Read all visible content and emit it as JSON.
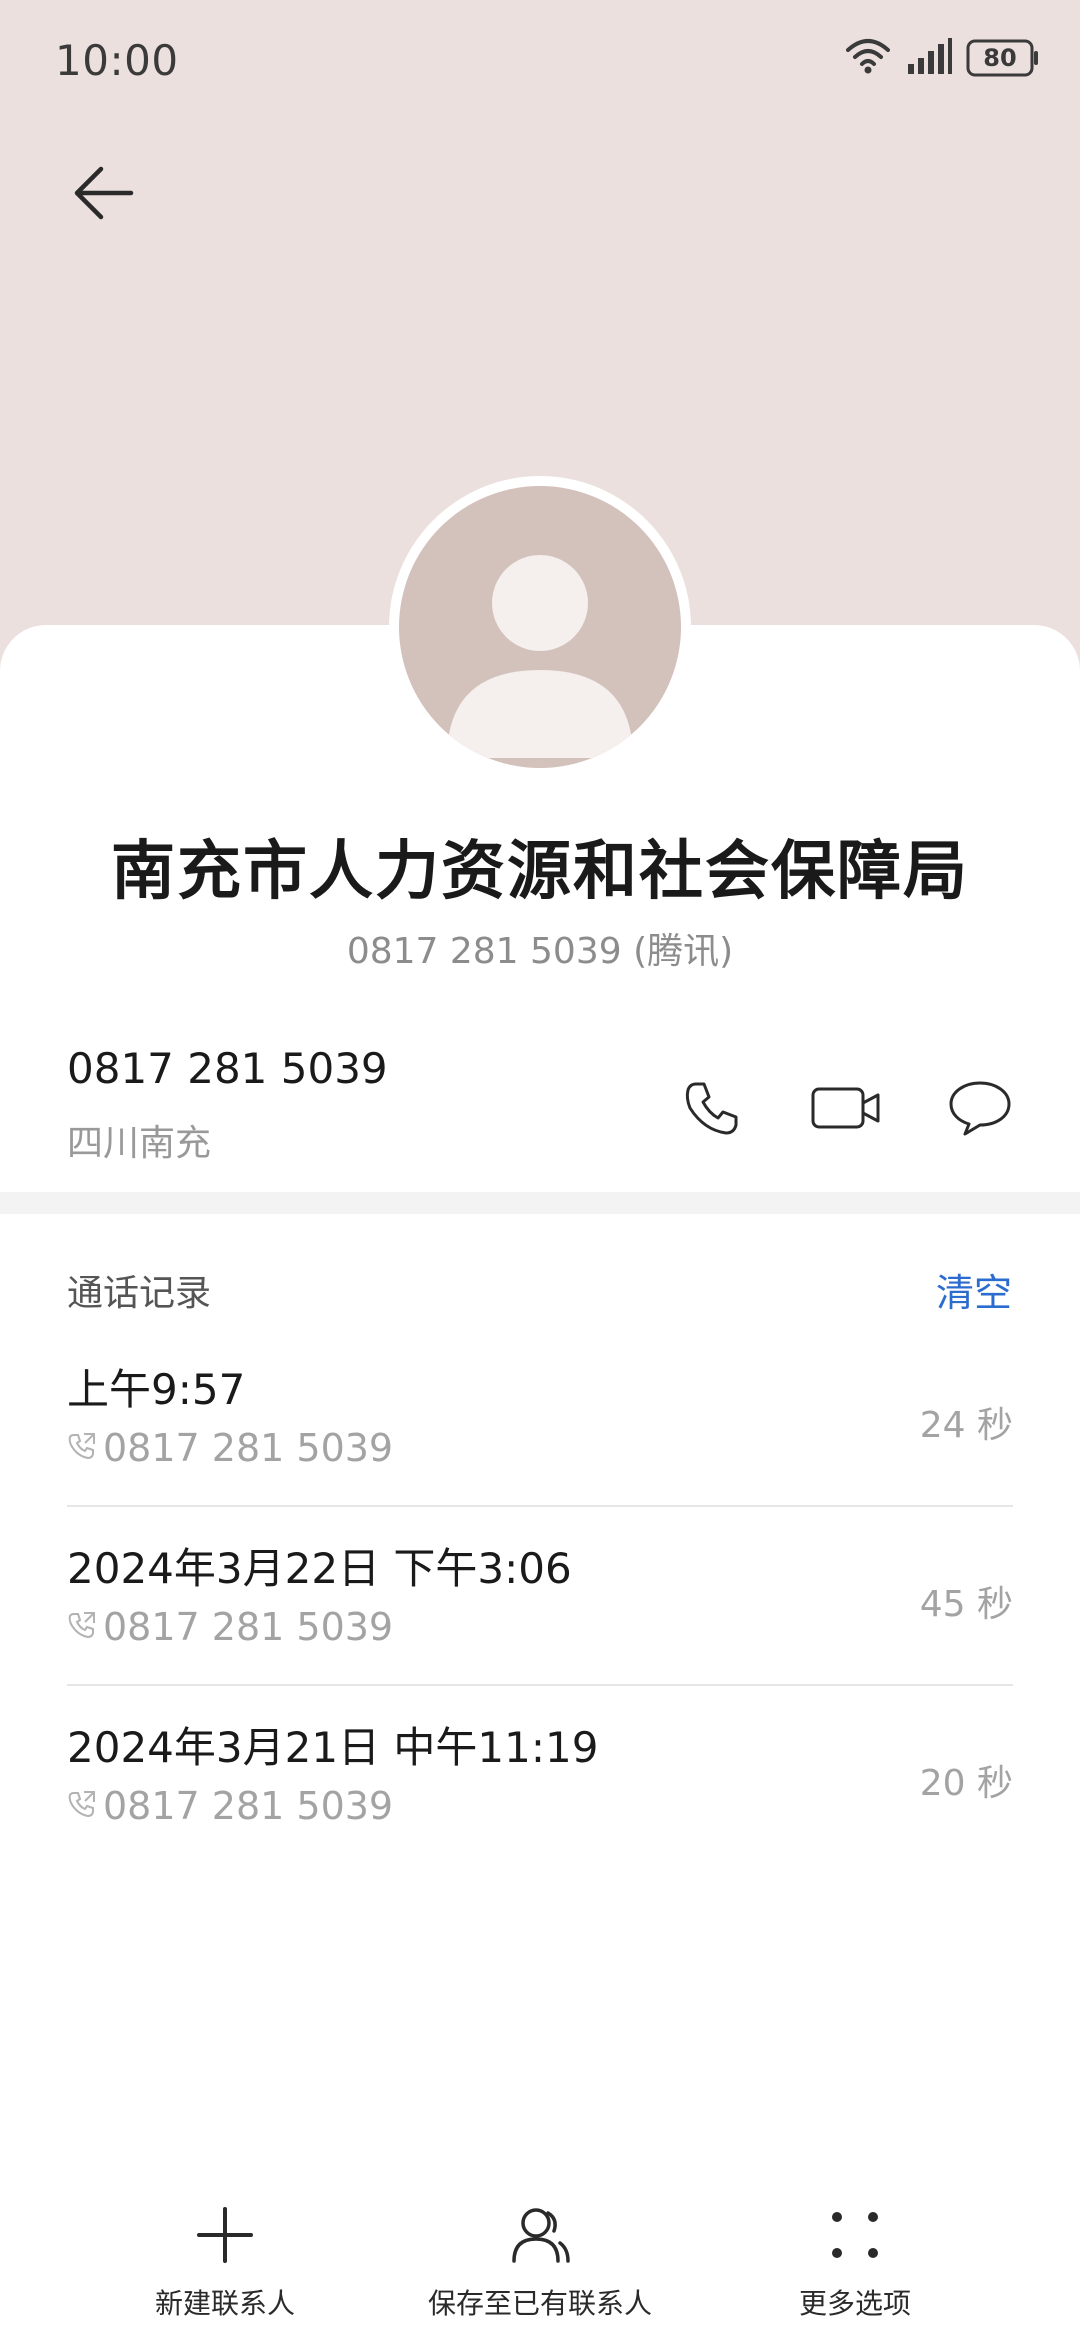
{
  "status_bar": {
    "time": "10:00",
    "battery": "80"
  },
  "contact": {
    "name": "南充市人力资源和社会保障局",
    "subtitle": "0817 281 5039 (腾讯)",
    "number": "0817 281 5039",
    "location": "四川南充"
  },
  "call_log": {
    "title": "通话记录",
    "clear_label": "清空",
    "entries": [
      {
        "time": "上午9:57",
        "number": "0817 281 5039",
        "duration": "24 秒"
      },
      {
        "time": "2024年3月22日 下午3:06",
        "number": "0817 281 5039",
        "duration": "45 秒"
      },
      {
        "time": "2024年3月21日 中午11:19",
        "number": "0817 281 5039",
        "duration": "20 秒"
      }
    ]
  },
  "bottom_bar": {
    "new_contact": "新建联系人",
    "save_existing": "保存至已有联系人",
    "more_options": "更多选项"
  },
  "colors": {
    "header_bg": "#ebe0dd",
    "avatar_bg": "#d3c1bb",
    "accent": "#2c6ccf"
  },
  "icons": [
    "back-arrow-icon",
    "wifi-icon",
    "signal-icon",
    "battery-icon",
    "phone-icon",
    "video-call-icon",
    "message-icon",
    "outgoing-call-icon",
    "plus-icon",
    "person-icon",
    "more-dots-icon"
  ]
}
